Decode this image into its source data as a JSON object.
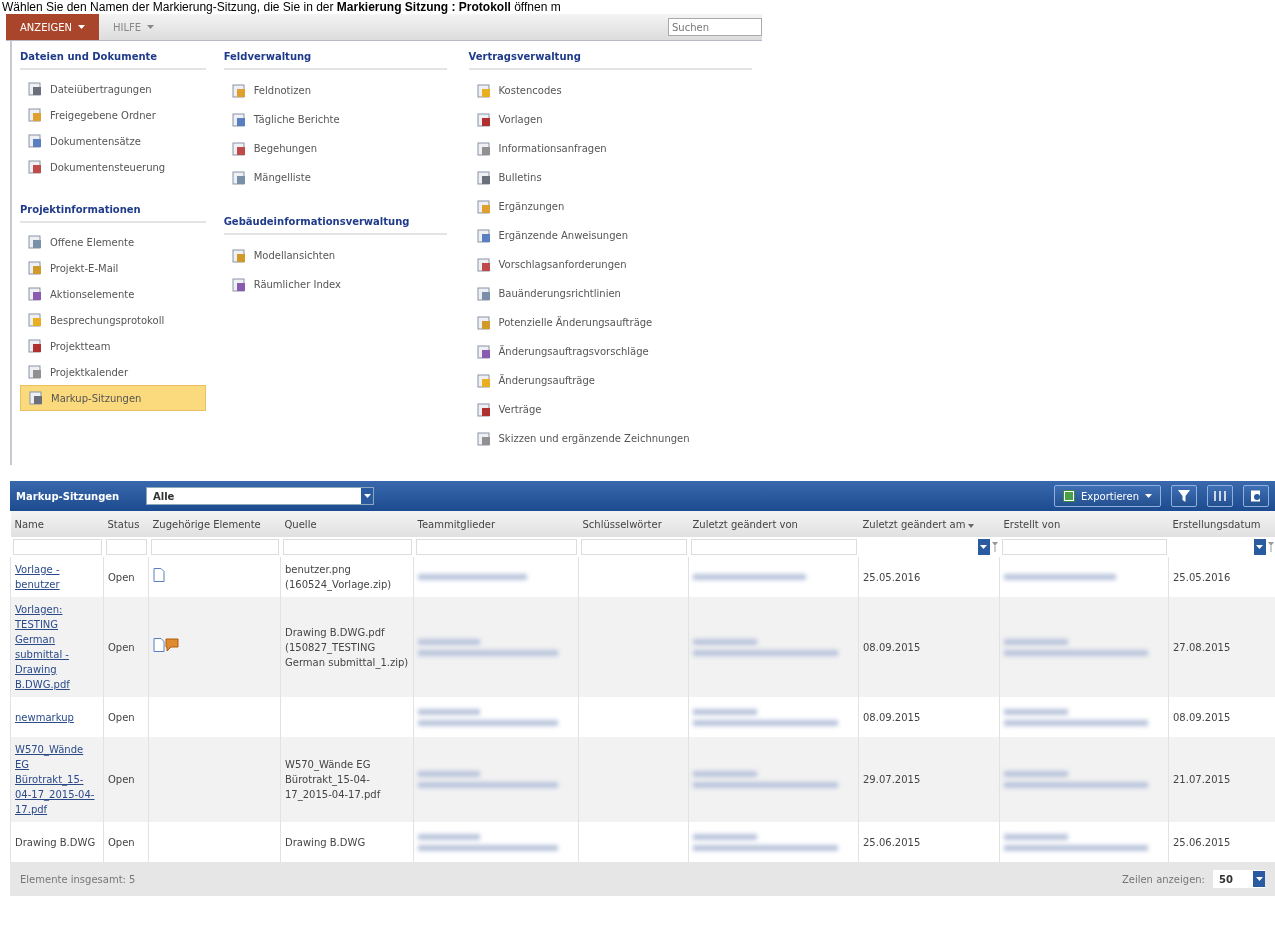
{
  "instruction": "Wählen Sie den Namen der Markierung-Sitzung, die Sie in der **Markierung Sitzung : Protokoll** öffnen m",
  "menubar": {
    "items": [
      {
        "label": "ANZEIGEN",
        "selected": true
      },
      {
        "label": "HILFE",
        "selected": false
      }
    ],
    "search": {
      "placeholder": "Suchen"
    }
  },
  "menu": {
    "columns": [
      {
        "sections": [
          {
            "title": "Dateien und Dokumente",
            "items": [
              {
                "label": "Dateiübertragungen",
                "selected": false
              },
              {
                "label": "Freigegebene Ordner",
                "selected": false
              },
              {
                "label": "Dokumentensätze",
                "selected": false
              },
              {
                "label": "Dokumentensteuerung",
                "selected": false
              }
            ]
          },
          {
            "title": "Projektinformationen",
            "items": [
              {
                "label": "Offene Elemente",
                "selected": false
              },
              {
                "label": "Projekt-E-Mail",
                "selected": false
              },
              {
                "label": "Aktionselemente",
                "selected": false
              },
              {
                "label": "Besprechungsprotokoll",
                "selected": false
              },
              {
                "label": "Projektteam",
                "selected": false
              },
              {
                "label": "Projektkalender",
                "selected": false
              },
              {
                "label": "Markup-Sitzungen",
                "selected": true
              }
            ]
          }
        ]
      },
      {
        "sections": [
          {
            "title": "Feldverwaltung",
            "items": [
              {
                "label": "Feldnotizen",
                "selected": false
              },
              {
                "label": "Tägliche Berichte",
                "selected": false
              },
              {
                "label": "Begehungen",
                "selected": false
              },
              {
                "label": "Mängelliste",
                "selected": false
              }
            ]
          },
          {
            "title": "Gebäudeinformationsverwaltung",
            "items": [
              {
                "label": "Modellansichten",
                "selected": false
              },
              {
                "label": "Räumlicher Index",
                "selected": false
              }
            ]
          }
        ]
      },
      {
        "sections": [
          {
            "title": "Vertragsverwaltung",
            "items": [
              {
                "label": "Kostencodes",
                "selected": false
              },
              {
                "label": "Vorlagen",
                "selected": false
              },
              {
                "label": "Informationsanfragen",
                "selected": false
              },
              {
                "label": "Bulletins",
                "selected": false
              },
              {
                "label": "Ergänzungen",
                "selected": false
              },
              {
                "label": "Ergänzende Anweisungen",
                "selected": false
              },
              {
                "label": "Vorschlagsanforderungen",
                "selected": false
              },
              {
                "label": "Bauänderungsrichtlinien",
                "selected": false
              },
              {
                "label": "Potenzielle Änderungsaufträge",
                "selected": false
              },
              {
                "label": "Änderungsauftragsvorschläge",
                "selected": false
              },
              {
                "label": "Änderungsaufträge",
                "selected": false
              },
              {
                "label": "Verträge",
                "selected": false
              },
              {
                "label": "Skizzen und ergänzende Zeichnungen",
                "selected": false
              }
            ]
          }
        ]
      }
    ]
  },
  "grid": {
    "title": "Markup-Sitzungen",
    "view": "Alle",
    "export": "Exportieren",
    "columns": [
      {
        "label": "Name",
        "date_filter": false,
        "sorted": false
      },
      {
        "label": "Status",
        "date_filter": false,
        "sorted": false
      },
      {
        "label": "Zugehörige Elemente",
        "date_filter": false,
        "sorted": false
      },
      {
        "label": "Quelle",
        "date_filter": false,
        "sorted": false
      },
      {
        "label": "Teammitglieder",
        "date_filter": false,
        "sorted": false
      },
      {
        "label": "Schlüsselwörter",
        "date_filter": false,
        "sorted": false
      },
      {
        "label": "Zuletzt geändert von",
        "date_filter": false,
        "sorted": false
      },
      {
        "label": "Zuletzt geändert am",
        "date_filter": true,
        "sorted": true
      },
      {
        "label": "Erstellt von",
        "date_filter": false,
        "sorted": false
      },
      {
        "label": "Erstellungsdatum",
        "date_filter": true,
        "sorted": false
      }
    ],
    "rows": [
      {
        "name": "Vorlage - benutzer",
        "link": true,
        "status": "Open",
        "related": [
          {
            "kind": "document"
          }
        ],
        "source": "benutzer.png (160524_Vorlage.zip)",
        "team_wrapped": false,
        "modified_by_wrapped": false,
        "modified_on": "25.05.2016",
        "created_by_wrapped": false,
        "created_on": "25.05.2016"
      },
      {
        "name": "Vorlagen: TESTING German submittal - Drawing B.DWG.pdf",
        "link": true,
        "status": "Open",
        "related": [
          {
            "kind": "document"
          },
          {
            "kind": "comment"
          }
        ],
        "source": "Drawing B.DWG.pdf (150827_TESTING German submittal_1.zip)",
        "team_wrapped": true,
        "modified_by_wrapped": true,
        "modified_on": "08.09.2015",
        "created_by_wrapped": true,
        "created_on": "27.08.2015"
      },
      {
        "name": "newmarkup",
        "link": true,
        "status": "Open",
        "related": [],
        "source": "",
        "team_wrapped": true,
        "modified_by_wrapped": true,
        "modified_on": "08.09.2015",
        "created_by_wrapped": true,
        "created_on": "08.09.2015"
      },
      {
        "name": "W570_Wände EG Bürotrakt_15-04-17_2015-04-17.pdf",
        "link": true,
        "status": "Open",
        "related": [],
        "source": "W570_Wände EG Bürotrakt_15-04-17_2015-04-17.pdf",
        "team_wrapped": true,
        "modified_by_wrapped": true,
        "modified_on": "29.07.2015",
        "created_by_wrapped": true,
        "created_on": "21.07.2015"
      },
      {
        "name": "Drawing B.DWG",
        "link": false,
        "status": "Open",
        "related": [],
        "source": "Drawing B.DWG",
        "team_wrapped": true,
        "modified_by_wrapped": true,
        "modified_on": "25.06.2015",
        "created_by_wrapped": true,
        "created_on": "25.06.2015"
      }
    ],
    "footer": {
      "total": "Elemente insgesamt: 5",
      "rows_label": "Zeilen anzeigen:",
      "rows_value": "50"
    }
  }
}
